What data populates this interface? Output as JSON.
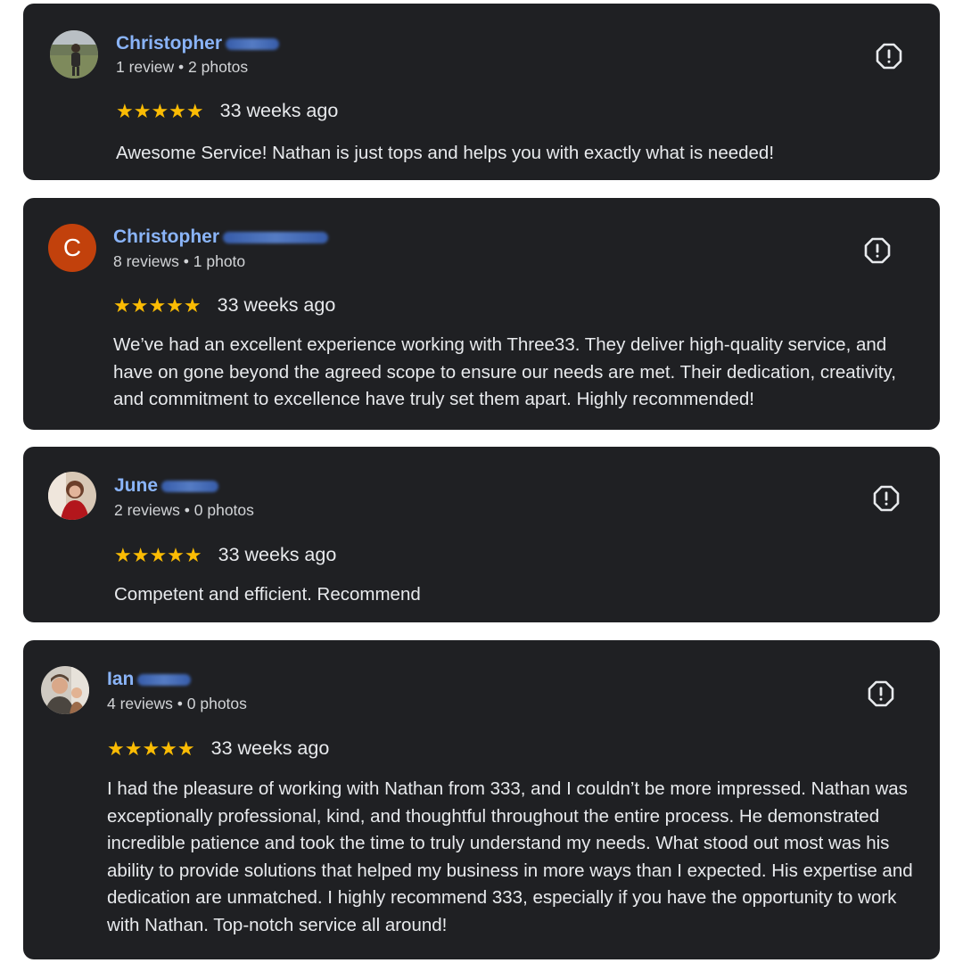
{
  "reviews": [
    {
      "name": "Christopher",
      "meta": "1 review • 2 photos",
      "stars": "★★★★★",
      "time": "33 weeks ago",
      "text": "Awesome Service! Nathan is just tops and helps you with exactly what is needed!"
    },
    {
      "name": "Christopher",
      "avatar_letter": "C",
      "meta": "8 reviews • 1 photo",
      "stars": "★★★★★",
      "time": "33 weeks ago",
      "text": "We’ve had an excellent experience working with Three33. They deliver high-quality service, and have on gone beyond the agreed scope to ensure our needs are met. Their dedication, creativity, and commitment to excellence have truly set them apart. Highly recommended!"
    },
    {
      "name": "June",
      "meta": "2 reviews • 0 photos",
      "stars": "★★★★★",
      "time": "33 weeks ago",
      "text": "Competent and efficient. Recommend"
    },
    {
      "name": "Ian",
      "meta": "4 reviews • 0 photos",
      "stars": "★★★★★",
      "time": "33 weeks ago",
      "text": "I had the pleasure of working with Nathan from 333, and I couldn’t be more impressed. Nathan was exceptionally professional, kind, and thoughtful throughout the entire process. He demonstrated incredible patience and took the time to truly understand my needs. What stood out most was his ability to provide solutions that helped my business in more ways than I expected. His expertise and dedication are unmatched. I highly recommend 333, especially if you have the opportunity to work with Nathan. Top-notch service all around!"
    }
  ],
  "icons": {
    "report": "report-flag-icon",
    "star": "star-icon"
  },
  "colors": {
    "card_bg": "#1f2023",
    "name": "#8ab4f8",
    "star": "#fbbc04",
    "text": "#e8eaed"
  }
}
